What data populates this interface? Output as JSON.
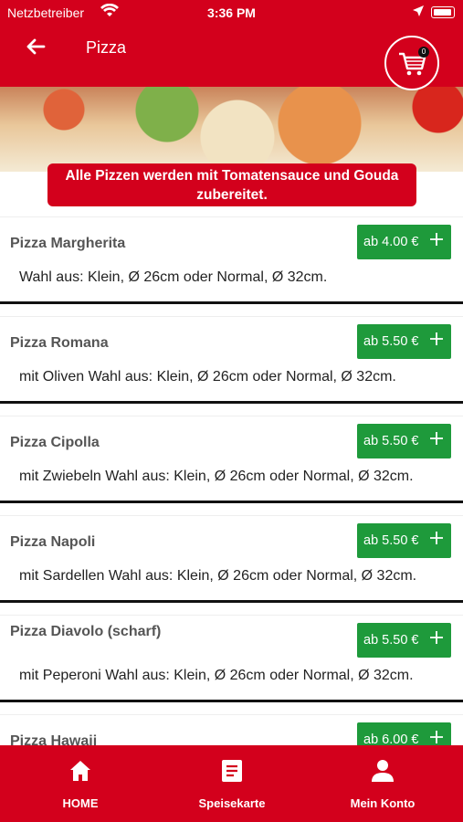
{
  "status_bar": {
    "carrier": "Netzbetreiber",
    "time": "3:36 PM"
  },
  "header": {
    "title": "Pizza",
    "cart_count": "0"
  },
  "notice": "Alle Pizzen werden mit Tomatensauce und Gouda zubereitet.",
  "menu_items": [
    {
      "name": "Pizza Margherita",
      "price": "ab 4.00 €",
      "description": "Wahl aus: Klein, Ø 26cm oder Normal, Ø 32cm."
    },
    {
      "name": "Pizza Romana",
      "price": "ab 5.50 €",
      "description": "mit Oliven Wahl aus: Klein, Ø 26cm oder Normal, Ø 32cm."
    },
    {
      "name": "Pizza Cipolla",
      "price": "ab 5.50 €",
      "description": "mit Zwiebeln Wahl aus: Klein, Ø 26cm oder Normal, Ø 32cm."
    },
    {
      "name": "Pizza Napoli",
      "price": "ab 5.50 €",
      "description": "mit Sardellen Wahl aus: Klein, Ø 26cm oder Normal, Ø 32cm."
    },
    {
      "name": "Pizza Diavolo (scharf)",
      "price": "ab 5.50 €",
      "description": "mit Peperoni Wahl aus: Klein, Ø 26cm oder Normal, Ø 32cm."
    },
    {
      "name": "Pizza Hawaii",
      "price": "ab 6.00 €",
      "description": ""
    }
  ],
  "tab_bar": [
    {
      "label": "HOME",
      "icon": "home-icon"
    },
    {
      "label": "Speisekarte",
      "icon": "menu-icon"
    },
    {
      "label": "Mein Konto",
      "icon": "account-icon"
    }
  ],
  "colors": {
    "brand_red": "#d3001c",
    "price_green": "#1e9a3b"
  }
}
